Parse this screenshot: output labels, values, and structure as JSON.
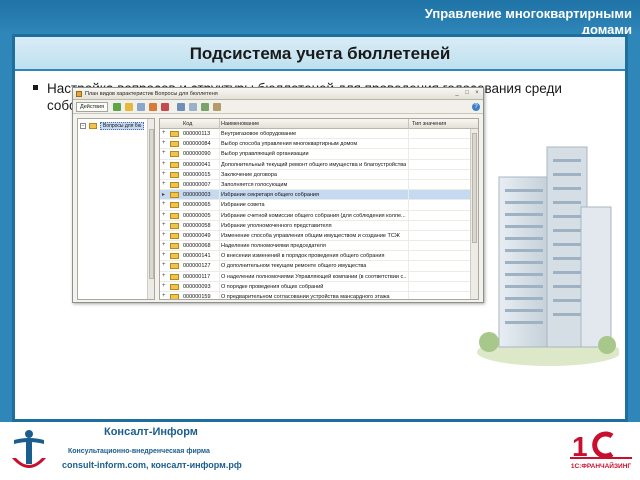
{
  "header": {
    "brand_title": "Управление многоквартирными домами"
  },
  "slide": {
    "title": "Подсистема учета бюллетеней",
    "bullet": "Настройка вопросов и структуры бюллетеней для проведения голосования среди собственников жилья"
  },
  "window": {
    "title": "План видов характеристик Вопросы для бюллетеня",
    "toolbar": {
      "actions_label": "Действия",
      "help_label": "?"
    },
    "tree": {
      "root_label": "Вопросы для бю"
    },
    "grid": {
      "columns": [
        "Код",
        "Наименование",
        "Тип значения"
      ],
      "rows": [
        {
          "code": "000000113",
          "name": "Внутригазовое оборудование",
          "selected": false
        },
        {
          "code": "000000084",
          "name": "Выбор способа управления многоквартирным домом",
          "selected": false
        },
        {
          "code": "000000090",
          "name": "Выбор управляющей организации",
          "selected": false
        },
        {
          "code": "000000041",
          "name": "Дополнительный текущий ремонт общего имущества и благоустройства",
          "selected": false
        },
        {
          "code": "000000015",
          "name": "Заключение договора",
          "selected": false
        },
        {
          "code": "000000007",
          "name": "Заполняется голосующим",
          "selected": false
        },
        {
          "code": "000000003",
          "name": "Избрание секретаря общего собрания",
          "selected": true
        },
        {
          "code": "000000065",
          "name": "Избрание совета",
          "selected": false
        },
        {
          "code": "000000005",
          "name": "Избрание счетной комиссии общего собрания (для соблюдения колле...",
          "selected": false
        },
        {
          "code": "000000058",
          "name": "Избрание уполномоченного представителя",
          "selected": false
        },
        {
          "code": "000000049",
          "name": "Изменение способа управления общим имуществом и создание ТСЖ",
          "selected": false
        },
        {
          "code": "000000068",
          "name": "Наделение полномочиями председателя",
          "selected": false
        },
        {
          "code": "000000141",
          "name": "О внесении изменений в порядок проведения общего собрания",
          "selected": false
        },
        {
          "code": "000000127",
          "name": "О дополнительном текущем ремонте общего имущества",
          "selected": false
        },
        {
          "code": "000000117",
          "name": "О наделении полномочиями Управляющей компании (в соответствии с...",
          "selected": false
        },
        {
          "code": "000000093",
          "name": "О порядке проведения общих собраний",
          "selected": false
        },
        {
          "code": "000000159",
          "name": "О предварительном согласовании устройства мансардного этажа",
          "selected": false
        },
        {
          "code": "000000165",
          "name": "О присвоении статуса общего собрания",
          "selected": false
        }
      ]
    }
  },
  "footer": {
    "company_name": "Консалт-Информ",
    "company_subtitle": "Консультационно-внедренческая фирма",
    "sites": "consult-inform.com, консалт-информ.рф",
    "partner_caption": "1С:ФРАНЧАЙЗИНГ"
  },
  "colors": {
    "slide_blue": "#2f86b8",
    "selection": "#c5d9f1",
    "folder": "#f1c34a",
    "brand_red": "#c8102e"
  }
}
